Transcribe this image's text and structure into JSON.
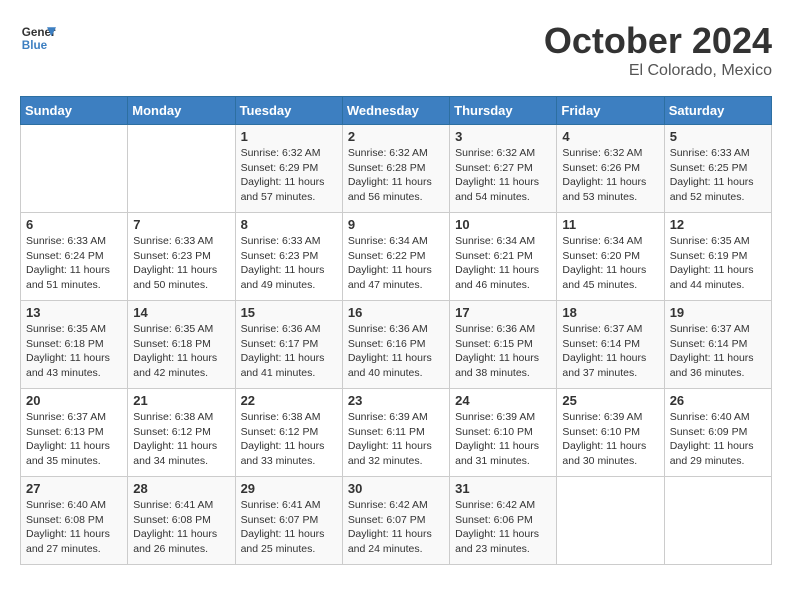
{
  "header": {
    "logo_line1": "General",
    "logo_line2": "Blue",
    "month": "October 2024",
    "location": "El Colorado, Mexico"
  },
  "weekdays": [
    "Sunday",
    "Monday",
    "Tuesday",
    "Wednesday",
    "Thursday",
    "Friday",
    "Saturday"
  ],
  "weeks": [
    [
      {
        "day": "",
        "info": ""
      },
      {
        "day": "",
        "info": ""
      },
      {
        "day": "1",
        "sunrise": "6:32 AM",
        "sunset": "6:29 PM",
        "daylight": "11 hours and 57 minutes."
      },
      {
        "day": "2",
        "sunrise": "6:32 AM",
        "sunset": "6:28 PM",
        "daylight": "11 hours and 56 minutes."
      },
      {
        "day": "3",
        "sunrise": "6:32 AM",
        "sunset": "6:27 PM",
        "daylight": "11 hours and 54 minutes."
      },
      {
        "day": "4",
        "sunrise": "6:32 AM",
        "sunset": "6:26 PM",
        "daylight": "11 hours and 53 minutes."
      },
      {
        "day": "5",
        "sunrise": "6:33 AM",
        "sunset": "6:25 PM",
        "daylight": "11 hours and 52 minutes."
      }
    ],
    [
      {
        "day": "6",
        "sunrise": "6:33 AM",
        "sunset": "6:24 PM",
        "daylight": "11 hours and 51 minutes."
      },
      {
        "day": "7",
        "sunrise": "6:33 AM",
        "sunset": "6:23 PM",
        "daylight": "11 hours and 50 minutes."
      },
      {
        "day": "8",
        "sunrise": "6:33 AM",
        "sunset": "6:23 PM",
        "daylight": "11 hours and 49 minutes."
      },
      {
        "day": "9",
        "sunrise": "6:34 AM",
        "sunset": "6:22 PM",
        "daylight": "11 hours and 47 minutes."
      },
      {
        "day": "10",
        "sunrise": "6:34 AM",
        "sunset": "6:21 PM",
        "daylight": "11 hours and 46 minutes."
      },
      {
        "day": "11",
        "sunrise": "6:34 AM",
        "sunset": "6:20 PM",
        "daylight": "11 hours and 45 minutes."
      },
      {
        "day": "12",
        "sunrise": "6:35 AM",
        "sunset": "6:19 PM",
        "daylight": "11 hours and 44 minutes."
      }
    ],
    [
      {
        "day": "13",
        "sunrise": "6:35 AM",
        "sunset": "6:18 PM",
        "daylight": "11 hours and 43 minutes."
      },
      {
        "day": "14",
        "sunrise": "6:35 AM",
        "sunset": "6:18 PM",
        "daylight": "11 hours and 42 minutes."
      },
      {
        "day": "15",
        "sunrise": "6:36 AM",
        "sunset": "6:17 PM",
        "daylight": "11 hours and 41 minutes."
      },
      {
        "day": "16",
        "sunrise": "6:36 AM",
        "sunset": "6:16 PM",
        "daylight": "11 hours and 40 minutes."
      },
      {
        "day": "17",
        "sunrise": "6:36 AM",
        "sunset": "6:15 PM",
        "daylight": "11 hours and 38 minutes."
      },
      {
        "day": "18",
        "sunrise": "6:37 AM",
        "sunset": "6:14 PM",
        "daylight": "11 hours and 37 minutes."
      },
      {
        "day": "19",
        "sunrise": "6:37 AM",
        "sunset": "6:14 PM",
        "daylight": "11 hours and 36 minutes."
      }
    ],
    [
      {
        "day": "20",
        "sunrise": "6:37 AM",
        "sunset": "6:13 PM",
        "daylight": "11 hours and 35 minutes."
      },
      {
        "day": "21",
        "sunrise": "6:38 AM",
        "sunset": "6:12 PM",
        "daylight": "11 hours and 34 minutes."
      },
      {
        "day": "22",
        "sunrise": "6:38 AM",
        "sunset": "6:12 PM",
        "daylight": "11 hours and 33 minutes."
      },
      {
        "day": "23",
        "sunrise": "6:39 AM",
        "sunset": "6:11 PM",
        "daylight": "11 hours and 32 minutes."
      },
      {
        "day": "24",
        "sunrise": "6:39 AM",
        "sunset": "6:10 PM",
        "daylight": "11 hours and 31 minutes."
      },
      {
        "day": "25",
        "sunrise": "6:39 AM",
        "sunset": "6:10 PM",
        "daylight": "11 hours and 30 minutes."
      },
      {
        "day": "26",
        "sunrise": "6:40 AM",
        "sunset": "6:09 PM",
        "daylight": "11 hours and 29 minutes."
      }
    ],
    [
      {
        "day": "27",
        "sunrise": "6:40 AM",
        "sunset": "6:08 PM",
        "daylight": "11 hours and 27 minutes."
      },
      {
        "day": "28",
        "sunrise": "6:41 AM",
        "sunset": "6:08 PM",
        "daylight": "11 hours and 26 minutes."
      },
      {
        "day": "29",
        "sunrise": "6:41 AM",
        "sunset": "6:07 PM",
        "daylight": "11 hours and 25 minutes."
      },
      {
        "day": "30",
        "sunrise": "6:42 AM",
        "sunset": "6:07 PM",
        "daylight": "11 hours and 24 minutes."
      },
      {
        "day": "31",
        "sunrise": "6:42 AM",
        "sunset": "6:06 PM",
        "daylight": "11 hours and 23 minutes."
      },
      {
        "day": "",
        "info": ""
      },
      {
        "day": "",
        "info": ""
      }
    ]
  ],
  "labels": {
    "sunrise": "Sunrise:",
    "sunset": "Sunset:",
    "daylight": "Daylight:"
  }
}
